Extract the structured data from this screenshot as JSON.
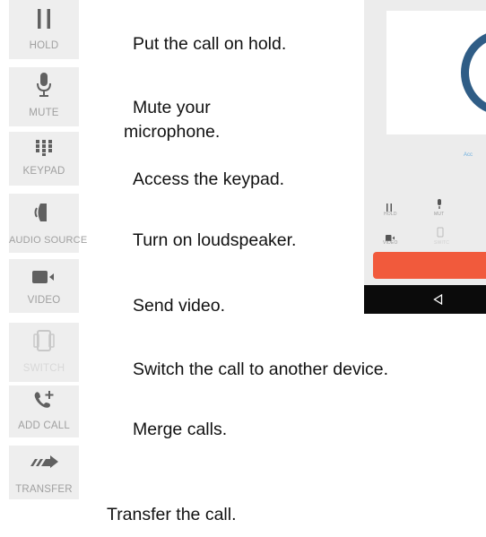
{
  "controls": [
    {
      "icon": "pause-icon",
      "label": "HOLD",
      "description": "Put the call on hold.",
      "enabled": true
    },
    {
      "icon": "microphone-icon",
      "label": "MUTE",
      "description_lines": [
        "Mute your",
        "microphone."
      ],
      "enabled": true
    },
    {
      "icon": "keypad-icon",
      "label": "KEYPAD",
      "description": "Access the keypad.",
      "enabled": true
    },
    {
      "icon": "speaker-icon",
      "label": "AUDIO SOURCE",
      "description": "Turn on loudspeaker.",
      "enabled": true
    },
    {
      "icon": "video-camera-icon",
      "label": "VIDEO",
      "description": "Send video.",
      "enabled": true
    },
    {
      "icon": "switch-device-icon",
      "label": "SWITCH",
      "description": "Switch the call to another device.",
      "enabled": false
    },
    {
      "icon": "add-call-icon",
      "label": "ADD CALL",
      "description": "Merge calls.",
      "enabled": true
    },
    {
      "icon": "transfer-icon",
      "label": "TRANSFER",
      "description": "Transfer the call.",
      "enabled": true
    }
  ],
  "phone_preview": {
    "account_text": "Acc",
    "hold_label": "HOLD",
    "mute_label": "MUT",
    "video_label": "VIDEO",
    "switch_label": "SWITC"
  },
  "colors": {
    "tile_background": "#eeeeee",
    "icon_color": "#606060",
    "disabled_color": "#c8c8c8",
    "end_call_red": "#f15a3c",
    "avatar_ring": "#2f5d86"
  }
}
